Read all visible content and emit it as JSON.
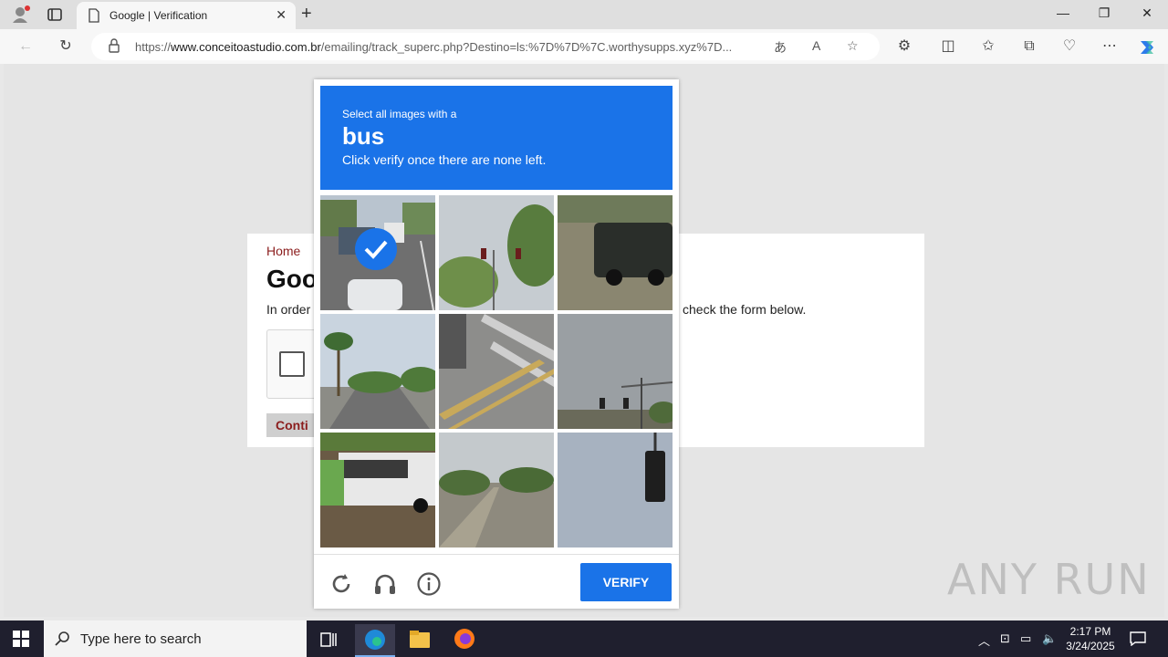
{
  "browser": {
    "tab_title": "Google | Verification",
    "url_prefix": "https://",
    "url_domain": "www.conceitoastudio.com.br",
    "url_path": "/emailing/track_superc.php?Destino=ls:%7D%7D%7C.worthysupps.xyz%7D..."
  },
  "page": {
    "home_link": "Home",
    "heading": "Goo",
    "desc_left": "In order",
    "desc_right": "check the form below.",
    "continue_label": "Conti"
  },
  "challenge": {
    "instruction_line1": "Select all images with a",
    "target": "bus",
    "instruction_line2": "Click verify once there are none left.",
    "verify_label": "VERIFY",
    "selected_tiles": [
      0
    ]
  },
  "watermark": "ANY RUN",
  "taskbar": {
    "search_placeholder": "Type here to search",
    "time": "2:17 PM",
    "date": "3/24/2025"
  },
  "colors": {
    "accent": "#1a73e8",
    "home_link": "#8b1d1d"
  }
}
